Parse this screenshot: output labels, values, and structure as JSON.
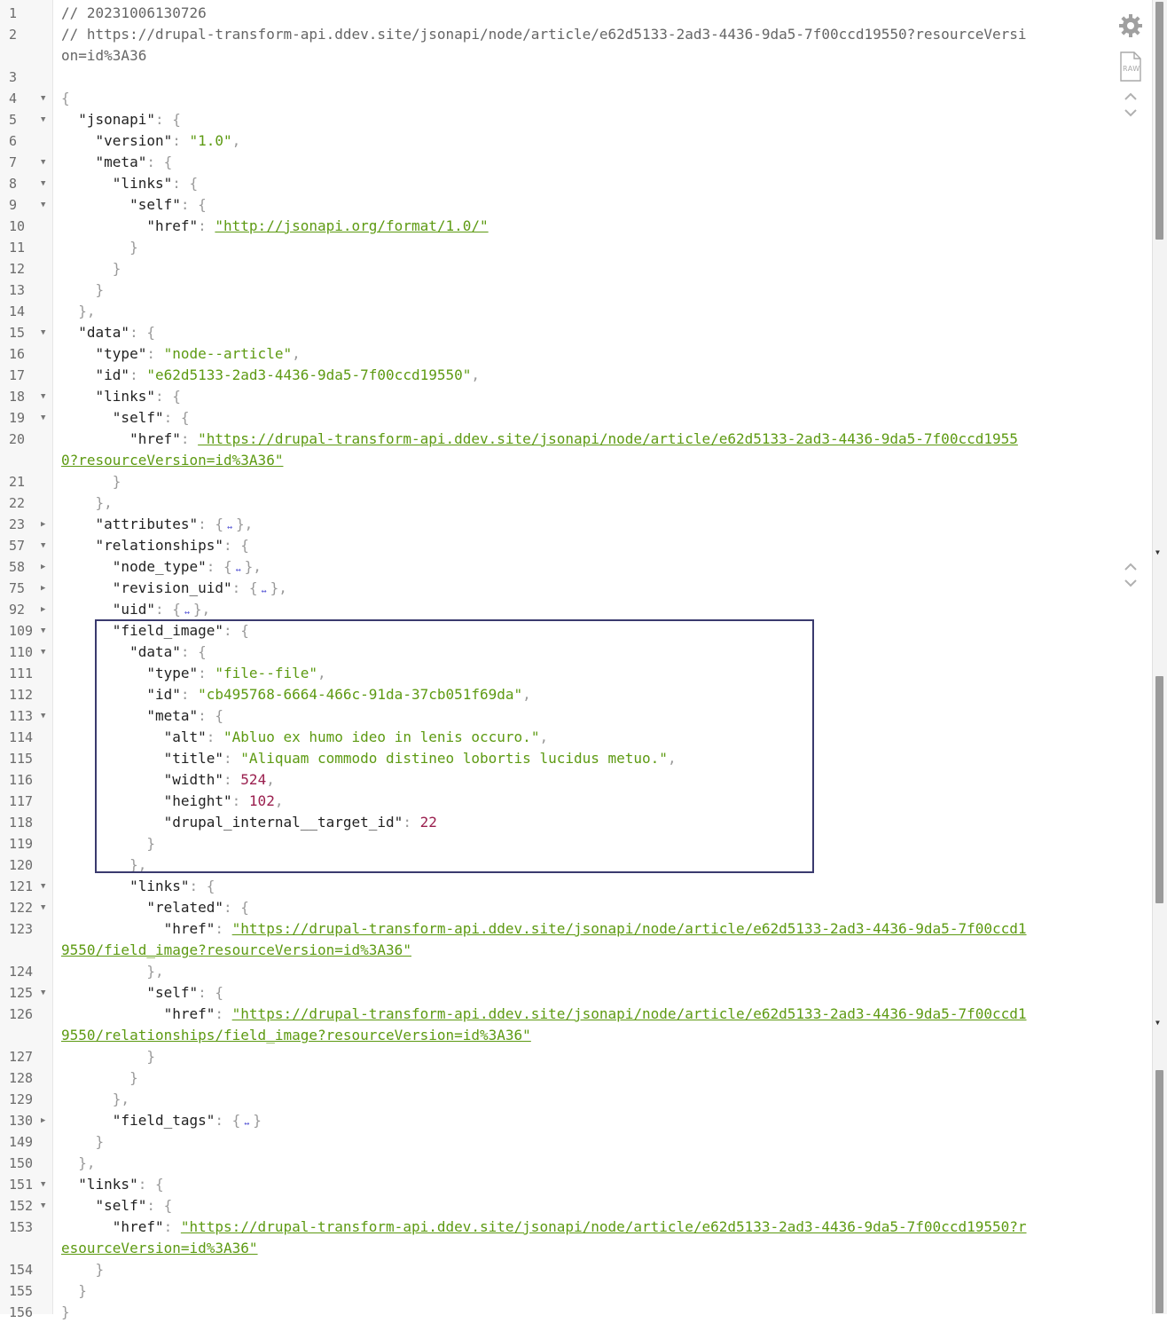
{
  "lines": [
    {
      "n": "1",
      "fold": "",
      "parts": [
        [
          "c",
          "// 20231006130726"
        ]
      ]
    },
    {
      "n": "2",
      "fold": "",
      "parts": [
        [
          "c",
          "// https://drupal-transform-api.ddev.site/jsonapi/node/article/e62d5133-2ad3-4436-9da5-7f00ccd19550?resourceVersion=id%3A36"
        ]
      ]
    },
    {
      "n": "3",
      "fold": "",
      "parts": []
    },
    {
      "n": "4",
      "fold": "open",
      "parts": [
        [
          "p",
          "{"
        ]
      ]
    },
    {
      "n": "5",
      "fold": "open",
      "parts": [
        [
          "k",
          "  \"jsonapi\""
        ],
        [
          "p",
          ": {"
        ]
      ]
    },
    {
      "n": "6",
      "fold": "",
      "parts": [
        [
          "k",
          "    \"version\""
        ],
        [
          "p",
          ": "
        ],
        [
          "s",
          "\"1.0\""
        ],
        [
          "p",
          ","
        ]
      ]
    },
    {
      "n": "7",
      "fold": "open",
      "parts": [
        [
          "k",
          "    \"meta\""
        ],
        [
          "p",
          ": {"
        ]
      ]
    },
    {
      "n": "8",
      "fold": "open",
      "parts": [
        [
          "k",
          "      \"links\""
        ],
        [
          "p",
          ": {"
        ]
      ]
    },
    {
      "n": "9",
      "fold": "open",
      "parts": [
        [
          "k",
          "        \"self\""
        ],
        [
          "p",
          ": {"
        ]
      ]
    },
    {
      "n": "10",
      "fold": "",
      "parts": [
        [
          "k",
          "          \"href\""
        ],
        [
          "p",
          ": "
        ],
        [
          "u",
          "\"http://jsonapi.org/format/1.0/\""
        ]
      ]
    },
    {
      "n": "11",
      "fold": "",
      "parts": [
        [
          "p",
          "        }"
        ]
      ]
    },
    {
      "n": "12",
      "fold": "",
      "parts": [
        [
          "p",
          "      }"
        ]
      ]
    },
    {
      "n": "13",
      "fold": "",
      "parts": [
        [
          "p",
          "    }"
        ]
      ]
    },
    {
      "n": "14",
      "fold": "",
      "parts": [
        [
          "p",
          "  },"
        ]
      ]
    },
    {
      "n": "15",
      "fold": "open",
      "parts": [
        [
          "k",
          "  \"data\""
        ],
        [
          "p",
          ": {"
        ]
      ]
    },
    {
      "n": "16",
      "fold": "",
      "parts": [
        [
          "k",
          "    \"type\""
        ],
        [
          "p",
          ": "
        ],
        [
          "s",
          "\"node--article\""
        ],
        [
          "p",
          ","
        ]
      ]
    },
    {
      "n": "17",
      "fold": "",
      "parts": [
        [
          "k",
          "    \"id\""
        ],
        [
          "p",
          ": "
        ],
        [
          "s",
          "\"e62d5133-2ad3-4436-9da5-7f00ccd19550\""
        ],
        [
          "p",
          ","
        ]
      ]
    },
    {
      "n": "18",
      "fold": "open",
      "parts": [
        [
          "k",
          "    \"links\""
        ],
        [
          "p",
          ": {"
        ]
      ]
    },
    {
      "n": "19",
      "fold": "open",
      "parts": [
        [
          "k",
          "      \"self\""
        ],
        [
          "p",
          ": {"
        ]
      ]
    },
    {
      "n": "20",
      "fold": "",
      "parts": [
        [
          "k",
          "        \"href\""
        ],
        [
          "p",
          ": "
        ],
        [
          "u",
          "\"https://drupal-transform-api.ddev.site/jsonapi/node/article/e62d5133-2ad3-4436-9da5-7f00ccd19550?resourceVersion=id%3A36\""
        ]
      ]
    },
    {
      "n": "21",
      "fold": "",
      "parts": [
        [
          "p",
          "      }"
        ]
      ]
    },
    {
      "n": "22",
      "fold": "",
      "parts": [
        [
          "p",
          "    },"
        ]
      ]
    },
    {
      "n": "23",
      "fold": "closed",
      "parts": [
        [
          "k",
          "    \"attributes\""
        ],
        [
          "p",
          ": {"
        ],
        [
          "e",
          ""
        ],
        [
          "p",
          "},"
        ]
      ]
    },
    {
      "n": "57",
      "fold": "open",
      "parts": [
        [
          "k",
          "    \"relationships\""
        ],
        [
          "p",
          ": {"
        ]
      ]
    },
    {
      "n": "58",
      "fold": "closed",
      "parts": [
        [
          "k",
          "      \"node_type\""
        ],
        [
          "p",
          ": {"
        ],
        [
          "e",
          ""
        ],
        [
          "p",
          "},"
        ]
      ]
    },
    {
      "n": "75",
      "fold": "closed",
      "parts": [
        [
          "k",
          "      \"revision_uid\""
        ],
        [
          "p",
          ": {"
        ],
        [
          "e",
          ""
        ],
        [
          "p",
          "},"
        ]
      ]
    },
    {
      "n": "92",
      "fold": "closed",
      "parts": [
        [
          "k",
          "      \"uid\""
        ],
        [
          "p",
          ": {"
        ],
        [
          "e",
          ""
        ],
        [
          "p",
          "},"
        ]
      ]
    },
    {
      "n": "109",
      "fold": "open",
      "parts": [
        [
          "k",
          "      \"field_image\""
        ],
        [
          "p",
          ": {"
        ]
      ]
    },
    {
      "n": "110",
      "fold": "open",
      "parts": [
        [
          "k",
          "        \"data\""
        ],
        [
          "p",
          ": {"
        ]
      ]
    },
    {
      "n": "111",
      "fold": "",
      "parts": [
        [
          "k",
          "          \"type\""
        ],
        [
          "p",
          ": "
        ],
        [
          "s",
          "\"file--file\""
        ],
        [
          "p",
          ","
        ]
      ]
    },
    {
      "n": "112",
      "fold": "",
      "parts": [
        [
          "k",
          "          \"id\""
        ],
        [
          "p",
          ": "
        ],
        [
          "s",
          "\"cb495768-6664-466c-91da-37cb051f69da\""
        ],
        [
          "p",
          ","
        ]
      ]
    },
    {
      "n": "113",
      "fold": "open",
      "parts": [
        [
          "k",
          "          \"meta\""
        ],
        [
          "p",
          ": {"
        ]
      ]
    },
    {
      "n": "114",
      "fold": "",
      "parts": [
        [
          "k",
          "            \"alt\""
        ],
        [
          "p",
          ": "
        ],
        [
          "s",
          "\"Abluo ex humo ideo in lenis occuro.\""
        ],
        [
          "p",
          ","
        ]
      ]
    },
    {
      "n": "115",
      "fold": "",
      "parts": [
        [
          "k",
          "            \"title\""
        ],
        [
          "p",
          ": "
        ],
        [
          "s",
          "\"Aliquam commodo distineo lobortis lucidus metuo.\""
        ],
        [
          "p",
          ","
        ]
      ]
    },
    {
      "n": "116",
      "fold": "",
      "parts": [
        [
          "k",
          "            \"width\""
        ],
        [
          "p",
          ": "
        ],
        [
          "n",
          "524"
        ],
        [
          "p",
          ","
        ]
      ]
    },
    {
      "n": "117",
      "fold": "",
      "parts": [
        [
          "k",
          "            \"height\""
        ],
        [
          "p",
          ": "
        ],
        [
          "n",
          "102"
        ],
        [
          "p",
          ","
        ]
      ]
    },
    {
      "n": "118",
      "fold": "",
      "parts": [
        [
          "k",
          "            \"drupal_internal__target_id\""
        ],
        [
          "p",
          ": "
        ],
        [
          "n",
          "22"
        ]
      ]
    },
    {
      "n": "119",
      "fold": "",
      "parts": [
        [
          "p",
          "          }"
        ]
      ]
    },
    {
      "n": "120",
      "fold": "",
      "parts": [
        [
          "p",
          "        },"
        ]
      ]
    },
    {
      "n": "121",
      "fold": "open",
      "parts": [
        [
          "k",
          "        \"links\""
        ],
        [
          "p",
          ": {"
        ]
      ]
    },
    {
      "n": "122",
      "fold": "open",
      "parts": [
        [
          "k",
          "          \"related\""
        ],
        [
          "p",
          ": {"
        ]
      ]
    },
    {
      "n": "123",
      "fold": "",
      "parts": [
        [
          "k",
          "            \"href\""
        ],
        [
          "p",
          ": "
        ],
        [
          "u",
          "\"https://drupal-transform-api.ddev.site/jsonapi/node/article/e62d5133-2ad3-4436-9da5-7f00ccd19550/field_image?resourceVersion=id%3A36\""
        ]
      ]
    },
    {
      "n": "124",
      "fold": "",
      "parts": [
        [
          "p",
          "          },"
        ]
      ]
    },
    {
      "n": "125",
      "fold": "open",
      "parts": [
        [
          "k",
          "          \"self\""
        ],
        [
          "p",
          ": {"
        ]
      ]
    },
    {
      "n": "126",
      "fold": "",
      "parts": [
        [
          "k",
          "            \"href\""
        ],
        [
          "p",
          ": "
        ],
        [
          "u",
          "\"https://drupal-transform-api.ddev.site/jsonapi/node/article/e62d5133-2ad3-4436-9da5-7f00ccd19550/relationships/field_image?resourceVersion=id%3A36\""
        ]
      ]
    },
    {
      "n": "127",
      "fold": "",
      "parts": [
        [
          "p",
          "          }"
        ]
      ]
    },
    {
      "n": "128",
      "fold": "",
      "parts": [
        [
          "p",
          "        }"
        ]
      ]
    },
    {
      "n": "129",
      "fold": "",
      "parts": [
        [
          "p",
          "      },"
        ]
      ]
    },
    {
      "n": "130",
      "fold": "closed",
      "parts": [
        [
          "k",
          "      \"field_tags\""
        ],
        [
          "p",
          ": {"
        ],
        [
          "e",
          ""
        ],
        [
          "p",
          "}"
        ]
      ]
    },
    {
      "n": "149",
      "fold": "",
      "parts": [
        [
          "p",
          "    }"
        ]
      ]
    },
    {
      "n": "150",
      "fold": "",
      "parts": [
        [
          "p",
          "  },"
        ]
      ]
    },
    {
      "n": "151",
      "fold": "open",
      "parts": [
        [
          "k",
          "  \"links\""
        ],
        [
          "p",
          ": {"
        ]
      ]
    },
    {
      "n": "152",
      "fold": "open",
      "parts": [
        [
          "k",
          "    \"self\""
        ],
        [
          "p",
          ": {"
        ]
      ]
    },
    {
      "n": "153",
      "fold": "",
      "parts": [
        [
          "k",
          "      \"href\""
        ],
        [
          "p",
          ": "
        ],
        [
          "u",
          "\"https://drupal-transform-api.ddev.site/jsonapi/node/article/e62d5133-2ad3-4436-9da5-7f00ccd19550?resourceVersion=id%3A36\""
        ]
      ]
    },
    {
      "n": "154",
      "fold": "",
      "parts": [
        [
          "p",
          "    }"
        ]
      ]
    },
    {
      "n": "155",
      "fold": "",
      "parts": [
        [
          "p",
          "  }"
        ]
      ]
    },
    {
      "n": "156",
      "fold": "",
      "parts": [
        [
          "p",
          "}"
        ]
      ]
    }
  ],
  "toolbar": {
    "settings_icon": "gear-icon",
    "raw_icon": "raw-file-icon",
    "raw_label": "RAW"
  },
  "colors": {
    "key": "#222222",
    "string": "#5d9a12",
    "number": "#9a1f4e",
    "comment": "#666666",
    "highlight_border": "#3a3a6e"
  }
}
